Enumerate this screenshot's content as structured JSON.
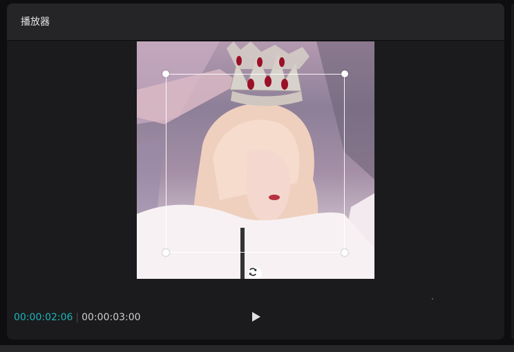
{
  "panel": {
    "title": "播放器"
  },
  "player": {
    "current_time": "00:00:02:06",
    "separator": "|",
    "total_time": "00:00:03:00"
  },
  "icons": {
    "rotate": "rotate-icon",
    "play": "play-icon"
  },
  "colors": {
    "accent": "#1fb5b8",
    "panel_bg": "#1b1b1e",
    "header_bg": "#252528"
  }
}
